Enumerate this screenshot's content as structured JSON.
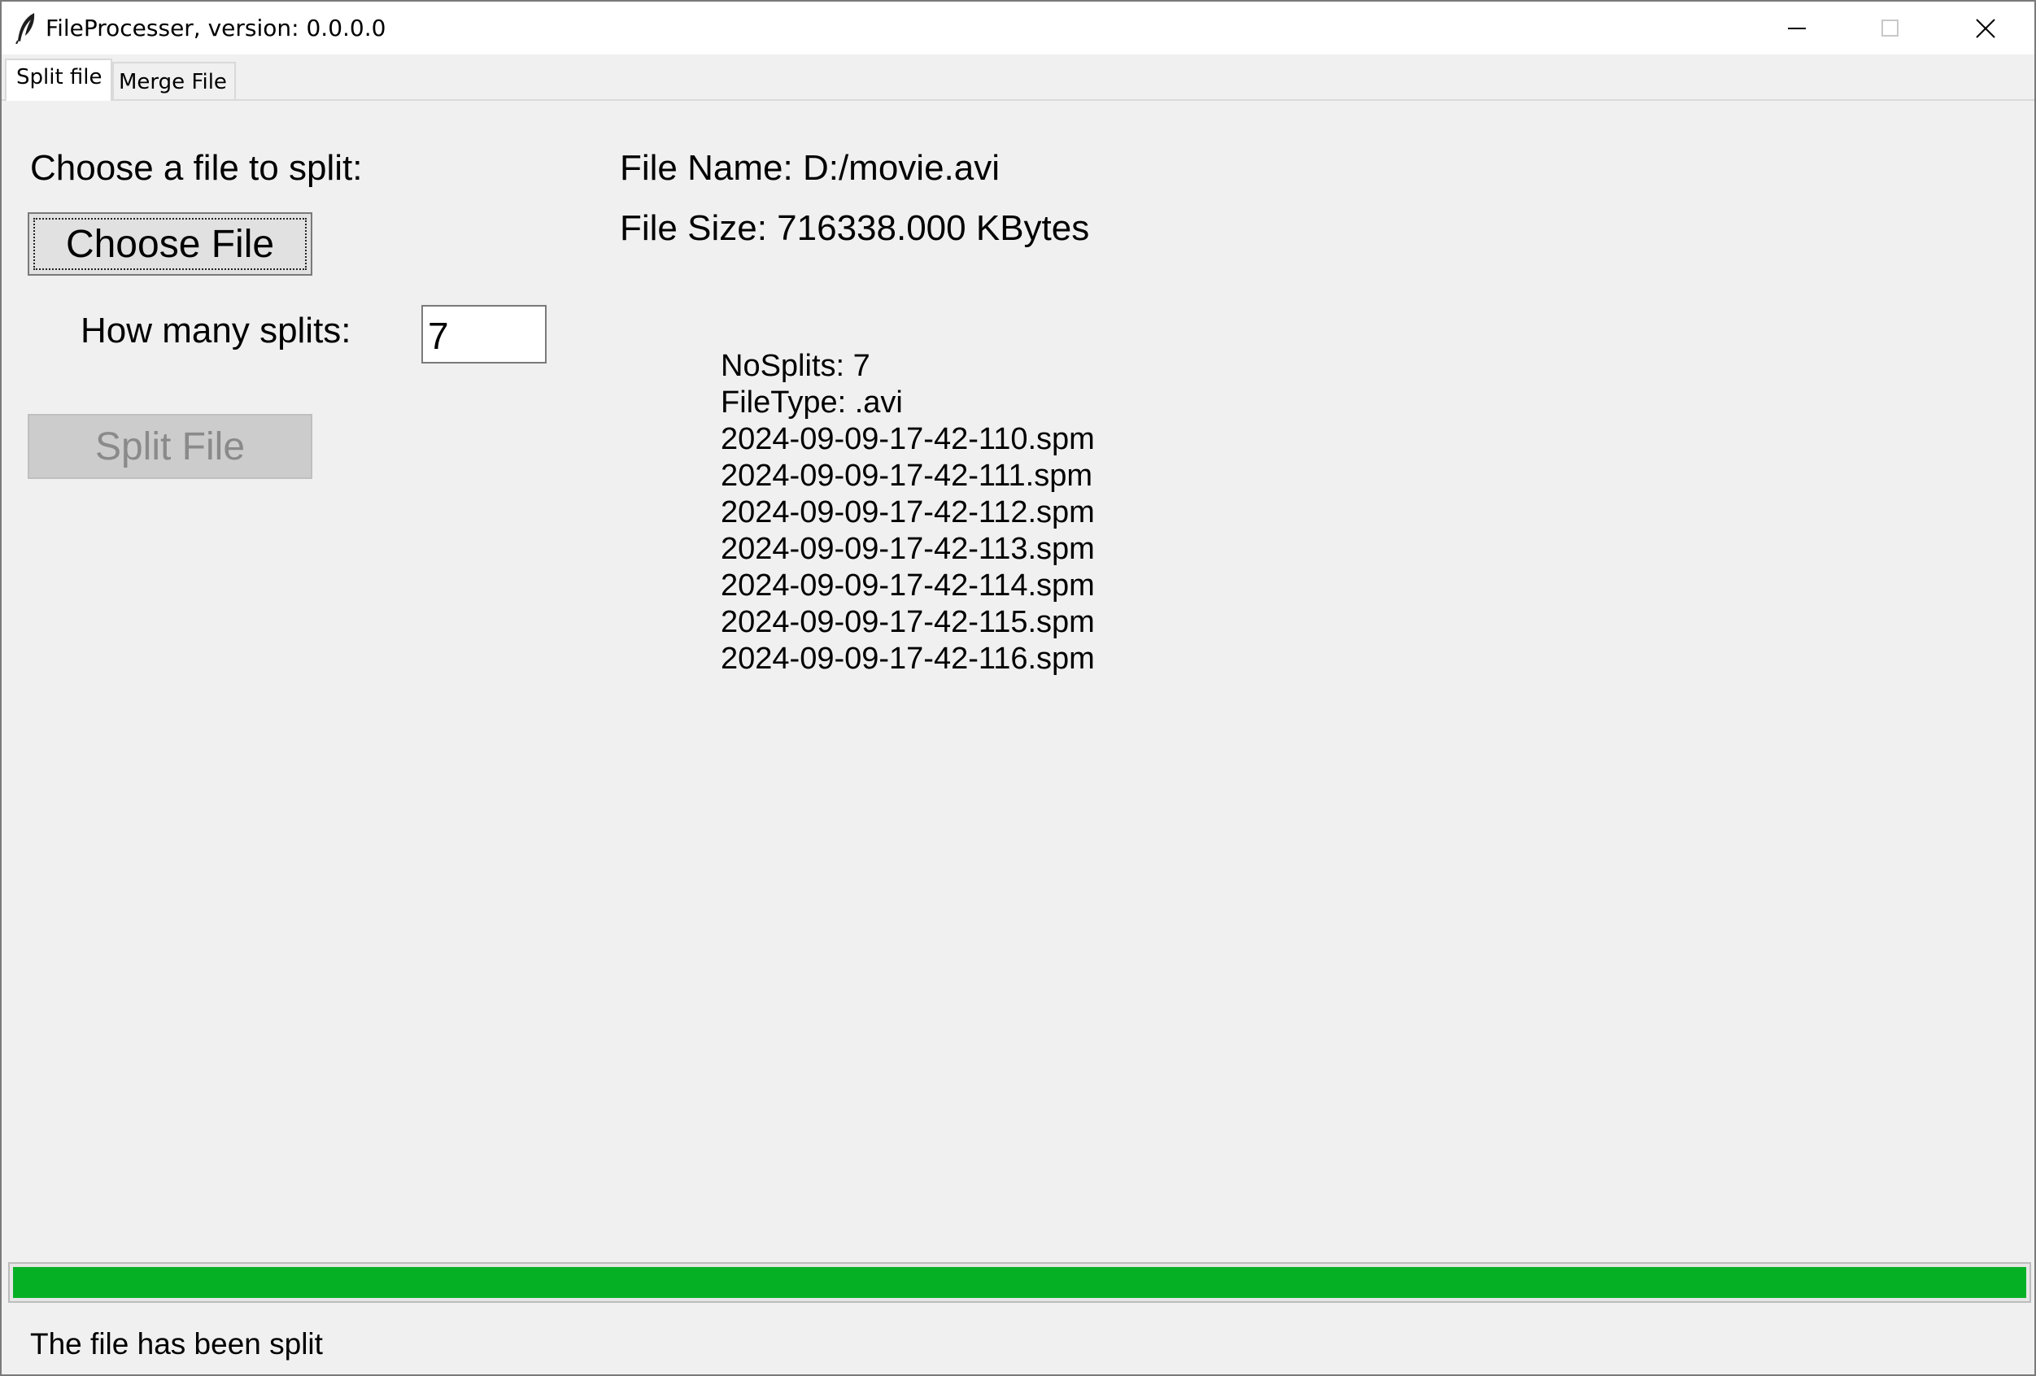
{
  "window": {
    "title": "FileProcesser, version: 0.0.0.0",
    "icon": "feather-icon",
    "controls": [
      "minimize-icon",
      "maximize-icon",
      "close-icon"
    ]
  },
  "tabs": [
    {
      "label": "Split file",
      "active": true
    },
    {
      "label": "Merge File",
      "active": false
    }
  ],
  "split": {
    "choose_label": "Choose a file to split:",
    "choose_button": "Choose File",
    "splits_label": "How many splits:",
    "splits_value": "7",
    "split_button": "Split File",
    "file_name": "File Name: D:/movie.avi",
    "file_size": "File Size: 716338.000 KBytes",
    "info_lines": [
      "NoSplits: 7",
      "FileType: .avi",
      "2024-09-09-17-42-110.spm",
      "2024-09-09-17-42-111.spm",
      "2024-09-09-17-42-112.spm",
      "2024-09-09-17-42-113.spm",
      "2024-09-09-17-42-114.spm",
      "2024-09-09-17-42-115.spm",
      "2024-09-09-17-42-116.spm"
    ]
  },
  "progress": {
    "percent": 100,
    "color": "#06b025"
  },
  "status": "The file has been split"
}
